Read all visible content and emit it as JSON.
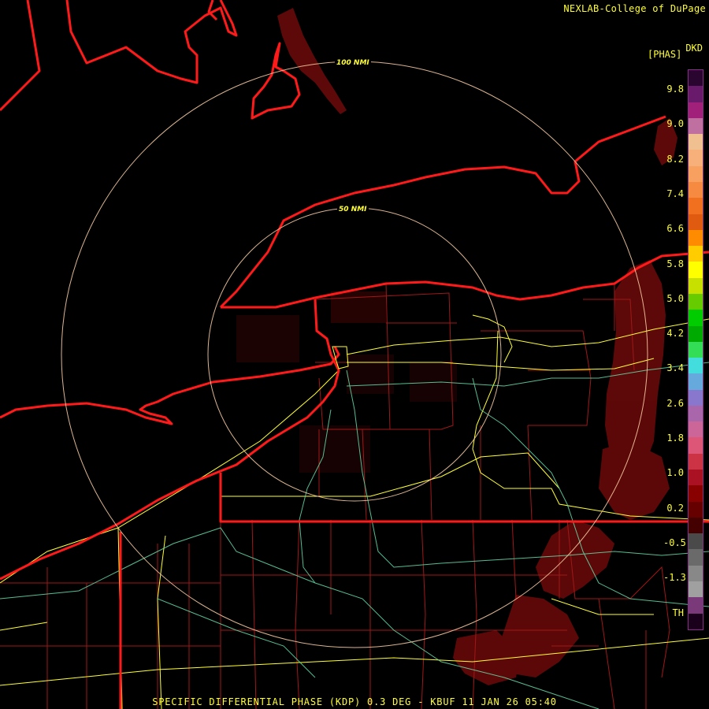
{
  "header": {
    "credit": "NEXLAB-College of DuPage"
  },
  "legend": {
    "product_code": "DKD",
    "units": "[PHAS]",
    "ticks": [
      "9.8",
      "9.0",
      "8.2",
      "7.4",
      "6.6",
      "5.8",
      "5.0",
      "4.2",
      "3.4",
      "2.6",
      "1.8",
      "1.0",
      "0.2",
      "-0.5",
      "-1.3",
      "TH"
    ],
    "colors": [
      "#2a0530",
      "#6a1a6a",
      "#a0207a",
      "#c070a0",
      "#f0c090",
      "#f8b07a",
      "#f8a060",
      "#f58a40",
      "#f07020",
      "#e05a10",
      "#ff8c00",
      "#ffcc00",
      "#ffff00",
      "#c8e000",
      "#66cc00",
      "#00cc00",
      "#00aa00",
      "#33dd55",
      "#44dddd",
      "#66aadd",
      "#8877cc",
      "#aa66aa",
      "#cc6699",
      "#dd5577",
      "#cc3344",
      "#aa1122",
      "#880000",
      "#660000",
      "#440000",
      "#4a4a4a",
      "#6a6a6a",
      "#888888",
      "#a0a0a0",
      "#7a3a7a",
      "#1a001a"
    ]
  },
  "range_rings": [
    {
      "label": "100 NMI"
    },
    {
      "label": "50 NMI"
    }
  ],
  "footer": {
    "caption": "SPECIFIC DIFFERENTIAL PHASE (KDP) 0.3 DEG - KBUF 11 JAN 26 05:40"
  }
}
